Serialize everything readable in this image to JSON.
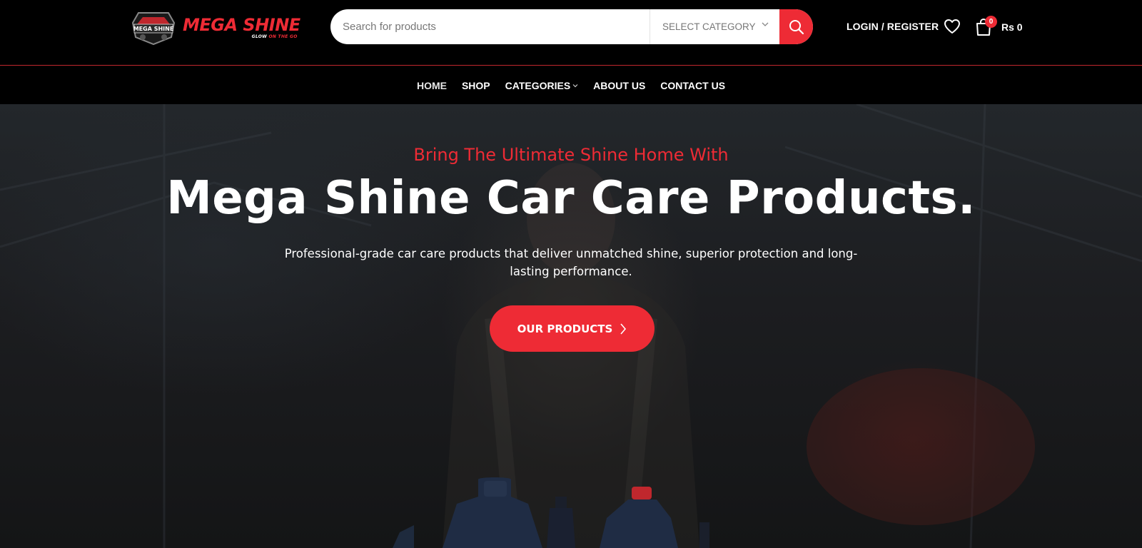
{
  "brand": {
    "name": "MEGA SHINE",
    "tagline_part1": "GLOW",
    "tagline_part2": "ON THE GO",
    "badge_text": "MEGA SHINE",
    "accent_color": "#ee2b35"
  },
  "search": {
    "placeholder": "Search for products",
    "category_label": "SELECT CATEGORY",
    "submit_icon": "search-icon"
  },
  "header": {
    "login_label": "LOGIN / REGISTER",
    "wishlist_icon": "heart-icon",
    "cart_icon": "shopping-bag-icon",
    "cart_count": "0",
    "cart_total": "Rs 0"
  },
  "nav": {
    "items": [
      {
        "label": "HOME",
        "active": true
      },
      {
        "label": "SHOP"
      },
      {
        "label": "CATEGORIES",
        "has_dropdown": true
      },
      {
        "label": "ABOUT US"
      },
      {
        "label": "CONTACT US"
      }
    ]
  },
  "hero": {
    "eyebrow": "Bring The Ultimate Shine Home With",
    "title": "Mega Shine Car Care Products.",
    "description": "Professional-grade car care products that deliver unmatched shine, superior protection and long-lasting performance.",
    "cta_label": "OUR PRODUCTS",
    "cta_icon": "chevron-right-icon"
  }
}
